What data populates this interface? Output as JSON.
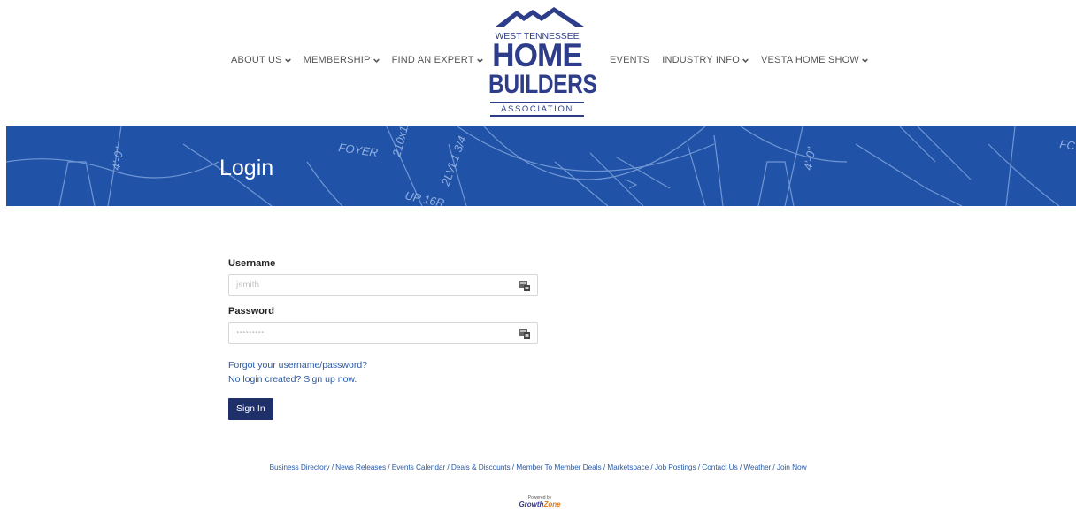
{
  "nav": {
    "left": [
      {
        "label": "ABOUT US",
        "has_dropdown": true
      },
      {
        "label": "MEMBERSHIP",
        "has_dropdown": true
      },
      {
        "label": "FIND AN EXPERT",
        "has_dropdown": true
      }
    ],
    "right": [
      {
        "label": "EVENTS",
        "has_dropdown": false
      },
      {
        "label": "INDUSTRY INFO",
        "has_dropdown": true
      },
      {
        "label": "VESTA HOME SHOW",
        "has_dropdown": true
      }
    ]
  },
  "logo": {
    "line1": "WEST TENNESSEE",
    "line2": "HOME",
    "line3": "BUILDERS",
    "line4": "ASSOCIATION",
    "color": "#2d3d8a"
  },
  "banner": {
    "title": "Login",
    "bg_color": "#2052a7"
  },
  "login": {
    "username_label": "Username",
    "username_placeholder": "jsmith",
    "password_label": "Password",
    "password_placeholder": "•••••••••",
    "forgot_link": "Forgot your username/password?",
    "signup_link": "No login created? Sign up now.",
    "signin_button": "Sign In",
    "button_color": "#1f2f69",
    "link_color": "#2a5ba6"
  },
  "footer": {
    "links": [
      "Business Directory",
      "News Releases",
      "Events Calendar",
      "Deals & Discounts",
      "Member To Member Deals",
      "Marketspace",
      "Job Postings",
      "Contact Us",
      "Weather",
      "Join Now"
    ],
    "powered_by": "Powered by",
    "powered_brand_a": "Growth",
    "powered_brand_b": "Zone"
  }
}
